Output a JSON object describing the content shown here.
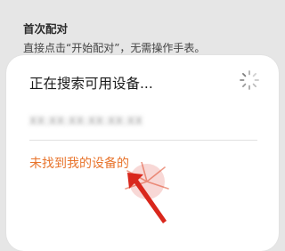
{
  "background": {
    "title": "首次配对",
    "description": "直接点击“开始配对”，无需操作手表。"
  },
  "dialog": {
    "title": "正在搜索可用设备...",
    "device_item": "XX:XX:XX:XX:XX:XX",
    "not_found_link": "未找到我的设备的"
  },
  "colors": {
    "accent": "#e8742c",
    "hint_arrow": "#d9271c",
    "sheet_bg": "#ffffff",
    "page_bg": "#e6e6e6"
  },
  "icons": {
    "spinner": "loading-spinner-icon",
    "hint": "tap-hint-arrow-icon"
  }
}
